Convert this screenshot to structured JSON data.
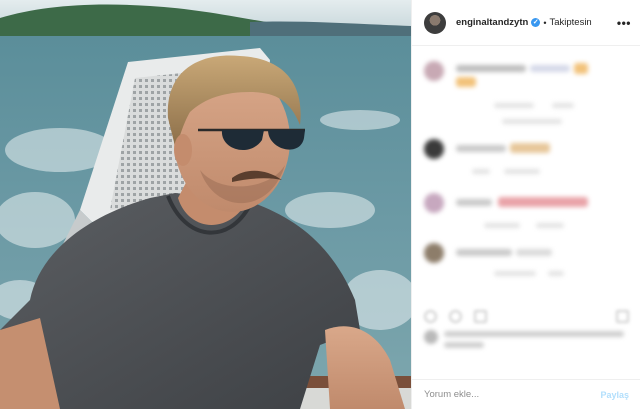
{
  "post": {
    "username": "enginaltandzytn",
    "verified_mark": "✓",
    "separator": "•",
    "follow_state": "Takiptesin",
    "more_icon": "more-dots-icon",
    "more_glyph": "•••"
  },
  "photo": {
    "subject": "man-with-sunglasses-on-boat",
    "icon": "post-photo"
  },
  "comments_blurred": true,
  "comment_input": {
    "placeholder": "Yorum ekle...",
    "value": ""
  },
  "share_label": "Paylaş",
  "colors": {
    "link_blue_disabled": "#b2dffc",
    "verified_blue": "#3897f0",
    "text": "#262626",
    "muted": "#8e8e8e"
  }
}
